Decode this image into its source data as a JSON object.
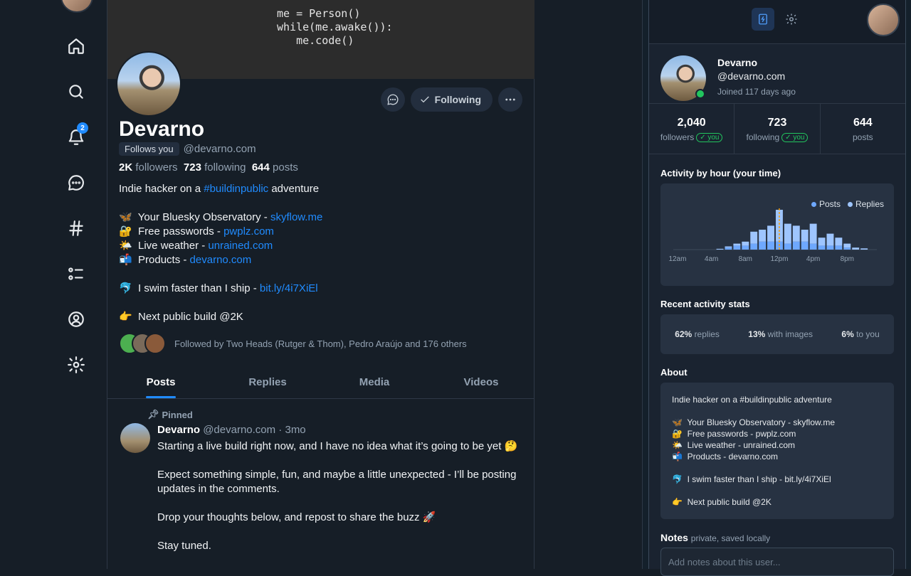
{
  "nav": {
    "notifications_count": "2"
  },
  "banner": {
    "code": "me = Person()\nwhile(me.awake()):\n   me.code()"
  },
  "profile": {
    "name": "Devarno",
    "follows_you": "Follows you",
    "handle": "@devarno.com",
    "followers_count": "2K",
    "followers_label": "followers",
    "following_count": "723",
    "following_label": "following",
    "posts_count": "644",
    "posts_label": "posts",
    "following_button": "Following",
    "bio": [
      {
        "pre": "Indie hacker on a ",
        "link": "#buildinpublic",
        "post": " adventure"
      },
      {
        "pre": "",
        "link": "",
        "post": ""
      },
      {
        "pre": "🦋  Your Bluesky Observatory - ",
        "link": "skyflow.me",
        "post": ""
      },
      {
        "pre": "🔐  Free passwords - ",
        "link": "pwplz.com",
        "post": ""
      },
      {
        "pre": "🌤️  Live weather - ",
        "link": "unrained.com",
        "post": ""
      },
      {
        "pre": "📬  Products - ",
        "link": "devarno.com",
        "post": ""
      },
      {
        "pre": "",
        "link": "",
        "post": ""
      },
      {
        "pre": "🐬  I swim faster than I ship - ",
        "link": "bit.ly/4i7XiEl",
        "post": ""
      },
      {
        "pre": "",
        "link": "",
        "post": ""
      },
      {
        "pre": "👉  Next public build @2K",
        "link": "",
        "post": ""
      }
    ],
    "followed_by": "Followed by Two Heads (Rutger & Thom), Pedro Araújo and 176 others"
  },
  "tabs": [
    "Posts",
    "Replies",
    "Media",
    "Videos"
  ],
  "post": {
    "pinned_label": "Pinned",
    "author": "Devarno",
    "meta": "@devarno.com · 3mo",
    "body": "Starting a live build right now, and I have no idea what it’s going to be yet 🤔\n\nExpect something simple, fun, and maybe a little unexpected - I’ll be posting updates in the comments.\n\nDrop your thoughts below, and repost to share the buzz 🚀\n\nStay tuned."
  },
  "panel": {
    "name": "Devarno",
    "handle": "@devarno.com",
    "joined": "Joined 117 days ago",
    "stats": [
      {
        "num": "2,040",
        "label": "followers",
        "you": "✓ you"
      },
      {
        "num": "723",
        "label": "following",
        "you": "✓ you"
      },
      {
        "num": "644",
        "label": "posts",
        "you": ""
      }
    ],
    "activity_title": "Activity by hour (your time)",
    "recent_title": "Recent activity stats",
    "recent": [
      {
        "value": "62%",
        "label": "replies"
      },
      {
        "value": "13%",
        "label": "with images"
      },
      {
        "value": "6%",
        "label": "to you"
      }
    ],
    "about_title": "About",
    "about_text": "Indie hacker on a #buildinpublic adventure\n\n🦋  Your Bluesky Observatory - skyflow.me\n🔐  Free passwords - pwplz.com\n🌤️  Live weather - unrained.com\n📬  Products - devarno.com\n\n🐬  I swim faster than I ship - bit.ly/4i7XiEl\n\n👉  Next public build @2K",
    "notes_title": "Notes",
    "notes_hint": "private, saved locally",
    "notes_placeholder": "Add notes about this user..."
  },
  "chart_data": {
    "type": "bar",
    "title": "Activity by hour (your time)",
    "x": [
      0,
      1,
      2,
      3,
      4,
      5,
      6,
      7,
      8,
      9,
      10,
      11,
      12,
      13,
      14,
      15,
      16,
      17,
      18,
      19,
      20,
      21,
      22,
      23
    ],
    "tick_labels": [
      "12am",
      "4am",
      "8am",
      "12pm",
      "4pm",
      "8pm"
    ],
    "series": [
      {
        "name": "Posts",
        "color": "#6ea8fe",
        "values": [
          0,
          0,
          0,
          0,
          0,
          0,
          0.5,
          1,
          1,
          1.5,
          2,
          2,
          2,
          1.5,
          2,
          2,
          1.5,
          1,
          1,
          1,
          0.5,
          0,
          0,
          0
        ]
      },
      {
        "name": "Replies",
        "color": "#9ec5fe",
        "values": [
          0,
          0,
          0,
          0,
          0,
          0.2,
          0.3,
          0.5,
          1,
          3,
          3,
          4,
          8,
          5,
          4,
          3,
          5,
          2,
          3,
          2,
          1,
          0.5,
          0.3,
          0
        ]
      }
    ],
    "current_hour": 12,
    "legend": "top-right"
  }
}
